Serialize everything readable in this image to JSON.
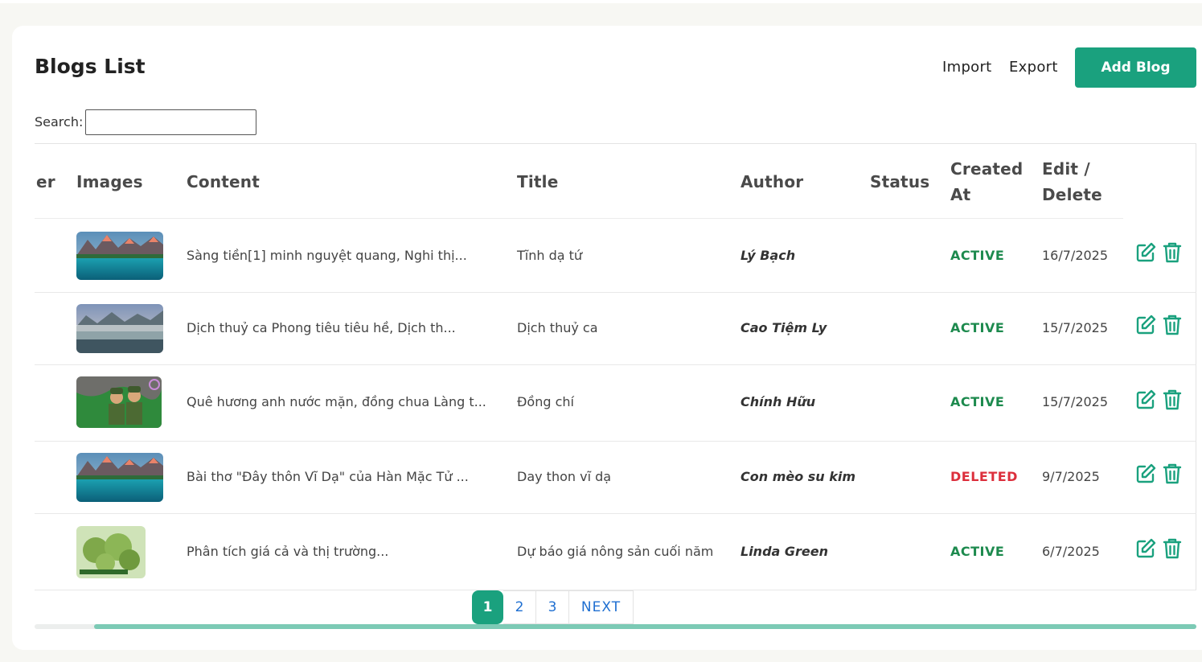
{
  "page": {
    "title": "Blogs List",
    "import_label": "Import",
    "export_label": "Export",
    "add_label": "Add Blog"
  },
  "search": {
    "label": "Search:",
    "value": "",
    "placeholder": ""
  },
  "table": {
    "headers": {
      "number": "er",
      "images": "Images",
      "content": "Content",
      "title": "Title",
      "author": "Author",
      "status": "Status",
      "created_line1": "Created",
      "created_line2": "At",
      "edit_line1": "Edit /",
      "edit_line2": "Delete"
    },
    "rows": [
      {
        "image": "mountain-lake-thumbnail",
        "content": "Sàng tiền[1] minh nguyệt quang, Nghi thị...",
        "title": "Tĩnh dạ tứ",
        "author": "Lý Bạch",
        "status": "ACTIVE",
        "created_at": "16/7/2025"
      },
      {
        "image": "misty-lake-thumbnail",
        "content": "Dịch thuỷ ca Phong tiêu tiêu hề, Dịch th...",
        "title": "Dịch thuỷ ca",
        "author": "Cao Tiệm Ly",
        "status": "ACTIVE",
        "created_at": "15/7/2025"
      },
      {
        "image": "soldiers-illustration-thumbnail",
        "content": "Quê hương anh nước mặn, đồng chua Làng t...",
        "title": "Đồng chí",
        "author": "Chính Hữu",
        "status": "ACTIVE",
        "created_at": "15/7/2025"
      },
      {
        "image": "mountain-lake-thumbnail",
        "content": "Bài thơ \"Đây thôn Vĩ Dạ\" của Hàn Mặc Tử ...",
        "title": "Day thon vĩ dạ",
        "author": "Con mèo su kim",
        "status": "DELETED",
        "created_at": "9/7/2025"
      },
      {
        "image": "durian-fruit-thumbnail",
        "content": "Phân tích giá cả và thị trường...",
        "title": "Dự báo giá nông sản cuối năm",
        "author": "Linda Green",
        "status": "ACTIVE",
        "created_at": "6/7/2025"
      }
    ]
  },
  "pagination": {
    "pages": [
      "1",
      "2",
      "3"
    ],
    "current": "1",
    "next_label": "NEXT"
  },
  "colors": {
    "accent": "#1aa17e",
    "active": "#1d8a4e",
    "deleted": "#dc2f3c",
    "link": "#1f6fd1"
  },
  "icons": {
    "edit": "edit-icon",
    "delete": "trash-icon"
  }
}
